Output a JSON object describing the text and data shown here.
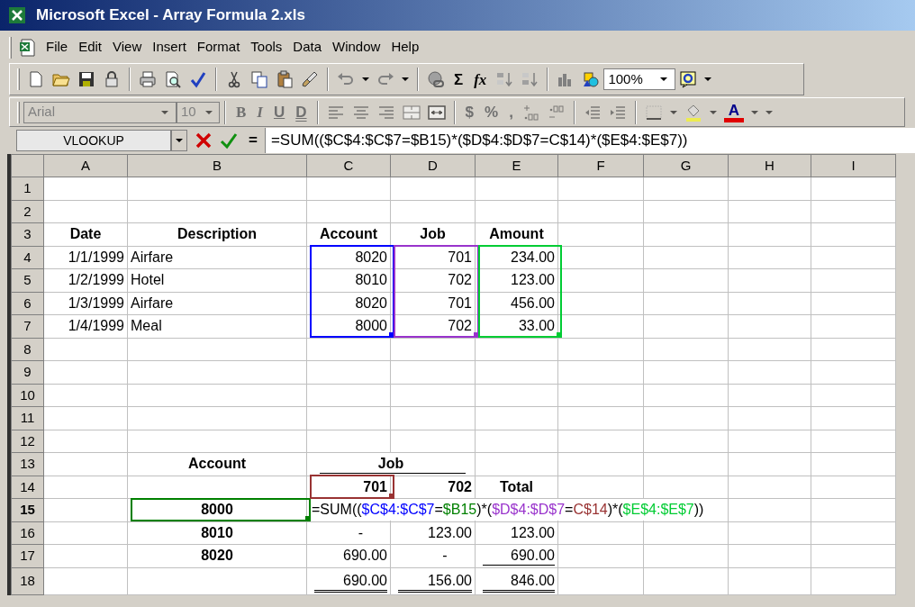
{
  "window": {
    "title": "Microsoft Excel - Array Formula 2.xls"
  },
  "menu": [
    "File",
    "Edit",
    "View",
    "Insert",
    "Format",
    "Tools",
    "Data",
    "Window",
    "Help"
  ],
  "standard_toolbar": {
    "autosum": "Σ",
    "function": "fx",
    "zoom": "100%"
  },
  "formatting_toolbar": {
    "disabled": true,
    "font": "Arial",
    "size": "10",
    "bold": "B",
    "italic": "I",
    "underline": "U",
    "double_underline": "D",
    "currency": "$",
    "percent": "%",
    "comma": ",",
    "font_color": "A"
  },
  "formula_bar": {
    "name_box": "VLOOKUP",
    "equals": "=",
    "formula": "=SUM(($C$4:$C$7=$B15)*($D$4:$D$7=C$14)*($E$4:$E$7))"
  },
  "columns": [
    {
      "label": "A",
      "selected": false
    },
    {
      "label": "B",
      "selected": false
    },
    {
      "label": "C",
      "selected": false
    },
    {
      "label": "D",
      "selected": false
    },
    {
      "label": "E",
      "selected": false
    },
    {
      "label": "F",
      "selected": false
    },
    {
      "label": "G",
      "selected": false
    },
    {
      "label": "H",
      "selected": false
    },
    {
      "label": "I",
      "selected": false
    }
  ],
  "rows": [
    {
      "label": "1",
      "selected": false
    },
    {
      "label": "2",
      "selected": false
    },
    {
      "label": "3",
      "selected": false,
      "cells": [
        {
          "text": "Date",
          "bold": true,
          "kind": "centered"
        },
        {
          "text": "Description",
          "bold": true,
          "kind": "centered"
        },
        {
          "text": "Account",
          "bold": true,
          "kind": "centered"
        },
        {
          "text": "Job",
          "bold": true,
          "kind": "centered"
        },
        {
          "text": "Amount",
          "bold": true,
          "kind": "centered"
        },
        null,
        null,
        null,
        null
      ]
    },
    {
      "label": "4",
      "selected": false,
      "cells": [
        {
          "text": "1/1/1999",
          "bold": false,
          "kind": "number"
        },
        {
          "text": "Airfare",
          "bold": false,
          "kind": "text"
        },
        {
          "text": "8020",
          "bold": false,
          "kind": "number",
          "color": "#0000ff"
        },
        {
          "text": "701",
          "bold": false,
          "kind": "number",
          "color": "#9933cc"
        },
        {
          "text": "234.00",
          "bold": false,
          "kind": "number",
          "color": "#00cc33"
        },
        null,
        null,
        null,
        null
      ]
    },
    {
      "label": "5",
      "selected": false,
      "cells": [
        {
          "text": "1/2/1999",
          "bold": false,
          "kind": "number"
        },
        {
          "text": "Hotel",
          "bold": false,
          "kind": "text"
        },
        {
          "text": "8010",
          "bold": false,
          "kind": "number",
          "color": "#0000ff"
        },
        {
          "text": "702",
          "bold": false,
          "kind": "number",
          "color": "#9933cc"
        },
        {
          "text": "123.00",
          "bold": false,
          "kind": "number",
          "color": "#00cc33"
        },
        null,
        null,
        null,
        null
      ]
    },
    {
      "label": "6",
      "selected": false,
      "cells": [
        {
          "text": "1/3/1999",
          "bold": false,
          "kind": "number"
        },
        {
          "text": "Airfare",
          "bold": false,
          "kind": "text"
        },
        {
          "text": "8020",
          "bold": false,
          "kind": "number",
          "color": "#0000ff"
        },
        {
          "text": "701",
          "bold": false,
          "kind": "number",
          "color": "#9933cc"
        },
        {
          "text": "456.00",
          "bold": false,
          "kind": "number",
          "color": "#00cc33"
        },
        null,
        null,
        null,
        null
      ]
    },
    {
      "label": "7",
      "selected": false,
      "cells": [
        {
          "text": "1/4/1999",
          "bold": false,
          "kind": "number"
        },
        {
          "text": "Meal",
          "bold": false,
          "kind": "text"
        },
        {
          "text": "8000",
          "bold": false,
          "kind": "number",
          "color": "#0000ff"
        },
        {
          "text": "702",
          "bold": false,
          "kind": "number",
          "color": "#9933cc"
        },
        {
          "text": "33.00",
          "bold": false,
          "kind": "number",
          "color": "#00cc33"
        },
        null,
        null,
        null,
        null
      ]
    },
    {
      "label": "8",
      "selected": false
    },
    {
      "label": "9",
      "selected": false
    },
    {
      "label": "10",
      "selected": false
    },
    {
      "label": "11",
      "selected": false
    },
    {
      "label": "12",
      "selected": false
    },
    {
      "label": "13",
      "selected": false,
      "cells": [
        null,
        {
          "text": "Account",
          "bold": true,
          "kind": "centered"
        },
        {
          "text": "Job",
          "bold": true,
          "kind": "group",
          "underline": true
        },
        null,
        null,
        null,
        null,
        null,
        null
      ]
    },
    {
      "label": "14",
      "selected": false,
      "cells": [
        null,
        null,
        {
          "text": "701",
          "bold": true,
          "kind": "number",
          "color": "#993333"
        },
        {
          "text": "702",
          "bold": true,
          "kind": "number"
        },
        {
          "text": "Total",
          "bold": true,
          "kind": "centered"
        },
        null,
        null,
        null,
        null
      ]
    },
    {
      "label": "15",
      "selected": true,
      "cells": [
        null,
        {
          "text": "8000",
          "bold": true,
          "kind": "centered",
          "color": "#008000"
        },
        {
          "kind": "editor",
          "segments": [
            {
              "text": "=SUM((",
              "color": "#000000"
            },
            {
              "text": "$C$4:$C$7",
              "color": "#0000ff"
            },
            {
              "text": "=",
              "color": "#000000"
            },
            {
              "text": "$B15",
              "color": "#008000"
            },
            {
              "text": ")*(",
              "color": "#000000"
            },
            {
              "text": "$D$4:$D$7",
              "color": "#9933cc"
            },
            {
              "text": "=",
              "color": "#000000"
            },
            {
              "text": "C$14",
              "color": "#993333"
            },
            {
              "text": ")*(",
              "color": "#000000"
            },
            {
              "text": "$E$4:$E$7",
              "color": "#00cc33"
            },
            {
              "text": "))",
              "color": "#000000"
            }
          ]
        },
        null,
        null,
        null,
        null,
        null,
        null
      ]
    },
    {
      "label": "16",
      "selected": false,
      "cells": [
        null,
        {
          "text": "8010",
          "bold": true,
          "kind": "centered"
        },
        {
          "text": "-",
          "bold": false,
          "kind": "dash"
        },
        {
          "text": "123.00",
          "bold": false,
          "kind": "number"
        },
        {
          "text": "123.00",
          "bold": false,
          "kind": "number"
        },
        null,
        null,
        null,
        null
      ]
    },
    {
      "label": "17",
      "selected": false,
      "cells": [
        null,
        {
          "text": "8020",
          "bold": true,
          "kind": "centered"
        },
        {
          "text": "690.00",
          "bold": false,
          "kind": "number"
        },
        {
          "text": "-",
          "bold": false,
          "kind": "dash"
        },
        {
          "text": "690.00",
          "bold": false,
          "kind": "number",
          "underline": true
        },
        null,
        null,
        null,
        null
      ]
    },
    {
      "label": "18",
      "selected": false,
      "cells": [
        null,
        null,
        {
          "text": "690.00",
          "bold": false,
          "kind": "number",
          "double_underline": true
        },
        {
          "text": "156.00",
          "bold": false,
          "kind": "number",
          "double_underline": true
        },
        {
          "text": "846.00",
          "bold": false,
          "kind": "number",
          "double_underline": true
        },
        null,
        null,
        null,
        null
      ]
    }
  ]
}
